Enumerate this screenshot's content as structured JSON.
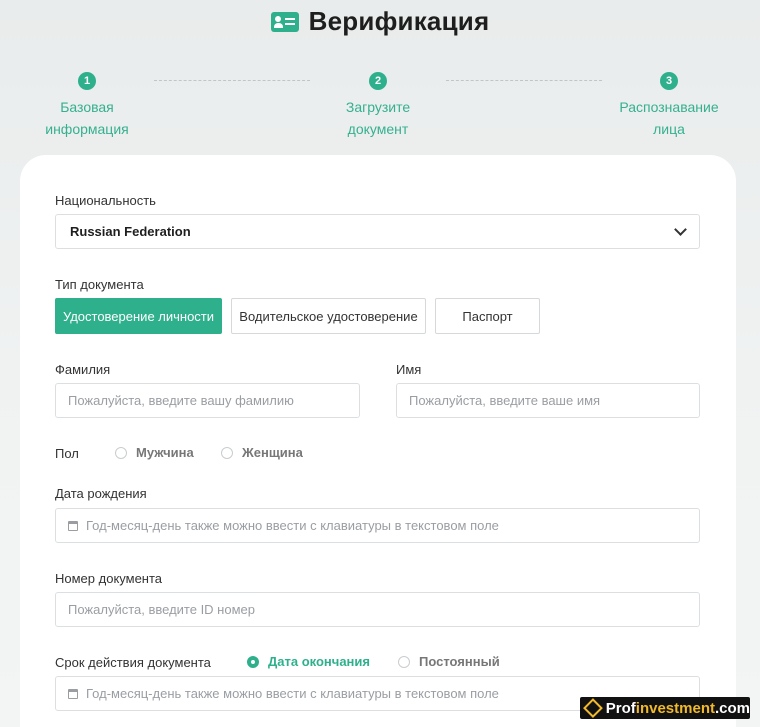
{
  "header": {
    "title": "Верификация",
    "icon": "id-card-icon"
  },
  "steps": [
    {
      "num": "1",
      "line1": "Базовая",
      "line2": "информация"
    },
    {
      "num": "2",
      "line1": "Загрузите",
      "line2": "документ"
    },
    {
      "num": "3",
      "line1": "Распознавание",
      "line2": "лица"
    }
  ],
  "form": {
    "nationality": {
      "label": "Национальность",
      "value": "Russian Federation"
    },
    "doc_type": {
      "label": "Тип документа",
      "options": [
        "Удостоверение личности",
        "Водительское удостоверение",
        "Паспорт"
      ],
      "selected": "Удостоверение личности"
    },
    "last_name": {
      "label": "Фамилия",
      "placeholder": "Пожалуйста, введите вашу фамилию"
    },
    "first_name": {
      "label": "Имя",
      "placeholder": "Пожалуйста, введите ваше имя"
    },
    "gender": {
      "label": "Пол",
      "options": [
        "Мужчина",
        "Женщина"
      ]
    },
    "birth_date": {
      "label": "Дата рождения",
      "placeholder": "Год-месяц-день также можно ввести с клавиатуры в текстовом поле"
    },
    "doc_number": {
      "label": "Номер документа",
      "placeholder": "Пожалуйста, введите ID номер"
    },
    "validity": {
      "label": "Срок действия документа",
      "options": [
        "Дата окончания",
        "Постоянный"
      ],
      "selected": "Дата окончания",
      "placeholder": "Год-месяц-день также можно ввести с клавиатуры в текстовом поле"
    }
  },
  "watermark": {
    "part1": "Prof",
    "part2": "investment",
    "part3": ".com"
  },
  "colors": {
    "accent": "#2fb08c",
    "step_text": "#35b08f"
  }
}
